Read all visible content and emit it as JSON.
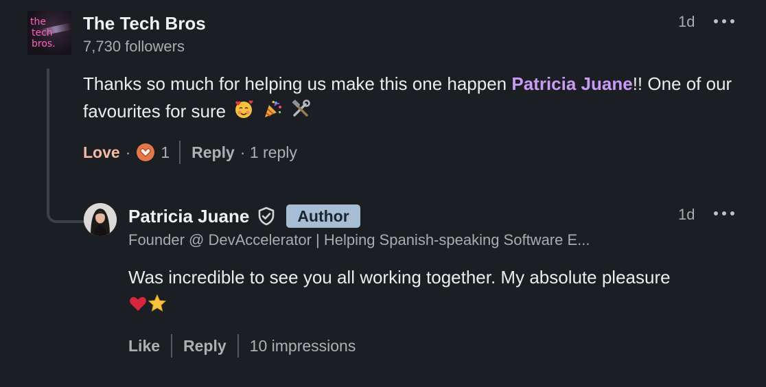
{
  "comment": {
    "logo_lines": [
      "the",
      "tech",
      "bros."
    ],
    "author": "The Tech Bros",
    "followers": "7,730 followers",
    "time": "1d",
    "text_before": "Thanks so much for helping us make this one happen ",
    "mention": "Patricia Juane",
    "text_after": "!! One of our favourites for sure",
    "emojis": [
      "smiling-face-with-hearts",
      "party-popper",
      "hammer-and-wrench"
    ],
    "reaction_label": "Love",
    "reaction_dot": "·",
    "reaction_count": "1",
    "reply_label": "Reply",
    "replies_text": "· 1 reply"
  },
  "reply": {
    "author": "Patricia Juane",
    "author_badge": "Author",
    "headline": "Founder @ DevAccelerator | Helping Spanish-speaking Software E...",
    "time": "1d",
    "text": "Was incredible to see you all working together. My absolute pleasure",
    "emojis": [
      "red-heart",
      "star"
    ],
    "like_label": "Like",
    "reply_label": "Reply",
    "impressions": "10 impressions"
  },
  "colors": {
    "background": "#1b1f23",
    "mention": "#c99bf5",
    "love": "#f6b9a5",
    "author_badge": "#a7bdd3"
  }
}
